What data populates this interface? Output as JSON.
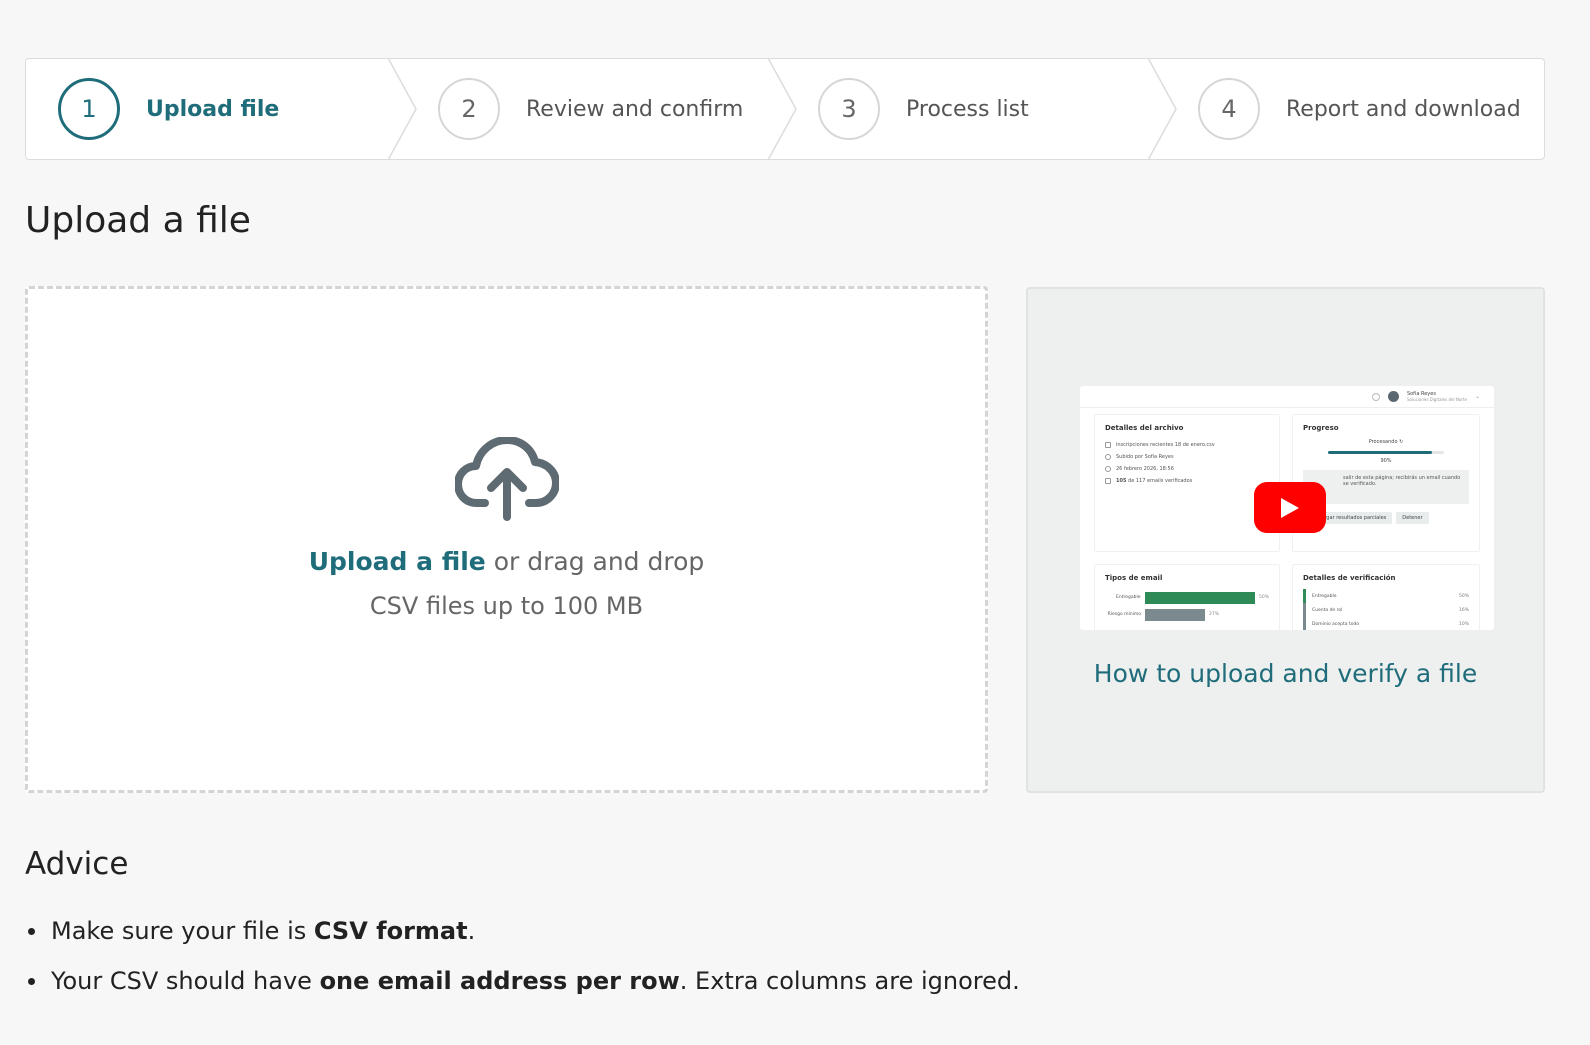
{
  "stepper": {
    "steps": [
      {
        "number": "1",
        "label": "Upload file",
        "state": "active"
      },
      {
        "number": "2",
        "label": "Review and confirm",
        "state": "pending"
      },
      {
        "number": "3",
        "label": "Process list",
        "state": "pending"
      },
      {
        "number": "4",
        "label": "Report and download",
        "state": "pending"
      }
    ]
  },
  "page": {
    "title": "Upload a file"
  },
  "dropzone": {
    "icon": "cloud-upload-icon",
    "link_text": "Upload a file",
    "rest_text": " or drag and drop",
    "hint": "CSV files up to 100 MB"
  },
  "video": {
    "caption": "How to upload and verify a file",
    "play_icon": "youtube-play-icon",
    "thumbnail": {
      "user_name": "Sofía Reyes",
      "user_org": "Soluciones Digitales del Norte",
      "file_panel": {
        "title": "Detalles del archivo",
        "rows": [
          "inscripciones recientes 18 de enero.csv",
          "Subido por Sofía Reyes",
          "26 febrero 2026, 18:56"
        ],
        "count_bold": "105",
        "count_rest": " de 117 emails verificados"
      },
      "progress_panel": {
        "title": "Progreso",
        "status": "Procesando",
        "percent_text": "90%",
        "percent": 90,
        "note": "salir de esta página; recibirás un email cuando se verificado.",
        "button_partial": "Descargar resultados parciales",
        "button_stop": "Detener"
      },
      "email_types": {
        "title": "Tipos de email",
        "rows": [
          {
            "label": "Entregable",
            "pct_text": "50%",
            "pct": 50
          },
          {
            "label": "Riesgo mínimo",
            "pct_text": "27%",
            "pct": 27
          }
        ]
      },
      "verification": {
        "title": "Detalles de verificación",
        "rows": [
          {
            "label": "Entregable",
            "pct_text": "50%"
          },
          {
            "label": "Cuenta de rol",
            "pct_text": "16%"
          },
          {
            "label": "Dominio acepta todo",
            "pct_text": "10%"
          }
        ]
      }
    }
  },
  "advice": {
    "title": "Advice",
    "items": [
      {
        "pre": "Make sure your file is ",
        "bold": "CSV format",
        "post": "."
      },
      {
        "pre": "Your CSV should have ",
        "bold": "one email address per row",
        "post": ". Extra columns are ignored."
      }
    ]
  },
  "colors": {
    "accent": "#1f6c7a",
    "youtube_red": "#ff0000",
    "bar_green": "#2e8b57",
    "bar_gray": "#7b8a8f"
  }
}
